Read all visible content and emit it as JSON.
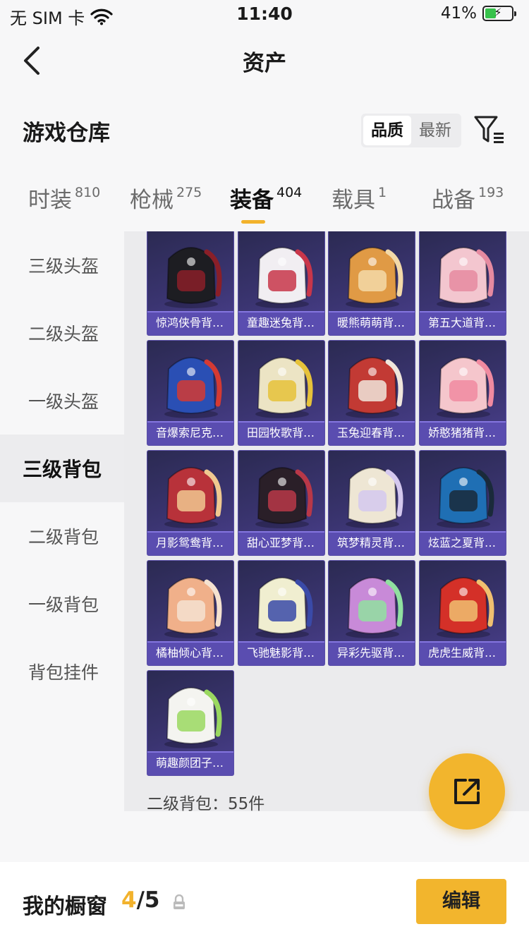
{
  "status_bar": {
    "carrier": "无 SIM 卡",
    "time": "11:40",
    "battery": "41%",
    "battery_level": 0.41
  },
  "nav": {
    "title": "资产"
  },
  "section": {
    "title": "游戏仓库",
    "sort_options": [
      "品质",
      "最新"
    ],
    "sort_active": 0
  },
  "tabs": [
    {
      "label": "时装",
      "count": "810"
    },
    {
      "label": "枪械",
      "count": "275"
    },
    {
      "label": "装备",
      "count": "404",
      "active": true
    },
    {
      "label": "载具",
      "count": "1"
    },
    {
      "label": "战备",
      "count": "193"
    }
  ],
  "sidebar": {
    "items": [
      "三级头盔",
      "二级头盔",
      "一级头盔",
      "三级背包",
      "二级背包",
      "一级背包",
      "背包挂件"
    ],
    "active_index": 3
  },
  "items": [
    {
      "name": "惊鸿侠骨背…",
      "icon": "black-armored-backpack"
    },
    {
      "name": "童趣迷兔背…",
      "icon": "bunny-bow-backpack"
    },
    {
      "name": "暖熊萌萌背…",
      "icon": "bear-backpack"
    },
    {
      "name": "第五大道背…",
      "icon": "pink-quilted-backpack"
    },
    {
      "name": "音爆索尼克…",
      "icon": "sonic-backpack"
    },
    {
      "name": "田园牧歌背…",
      "icon": "flower-basket-backpack"
    },
    {
      "name": "玉兔迎春背…",
      "icon": "red-rabbit-backpack"
    },
    {
      "name": "娇憨猪猪背…",
      "icon": "piggy-backpack"
    },
    {
      "name": "月影鸳鸯背…",
      "icon": "feather-backpack"
    },
    {
      "name": "甜心亚梦背…",
      "icon": "quilted-dark-backpack"
    },
    {
      "name": "筑梦精灵背…",
      "icon": "fairy-backpack"
    },
    {
      "name": "炫蓝之夏背…",
      "icon": "blue-summer-backpack"
    },
    {
      "name": "橘柚倾心背…",
      "icon": "citrus-backpack"
    },
    {
      "name": "飞驰魅影背…",
      "icon": "racer-backpack"
    },
    {
      "name": "异彩先驱背…",
      "icon": "colorful-monster-backpack"
    },
    {
      "name": "虎虎生威背…",
      "icon": "tiger-backpack"
    },
    {
      "name": "萌趣颜团子…",
      "icon": "dumpling-backpack"
    }
  ],
  "grid_footer": "二级背包：55件",
  "bottom_bar": {
    "label": "我的橱窗",
    "current": "4",
    "separator": "/",
    "total": "5",
    "edit_label": "编辑"
  },
  "colors": {
    "accent": "#f2b52d",
    "card_bg": "#3a3470",
    "card_label": "#5a4db0"
  }
}
